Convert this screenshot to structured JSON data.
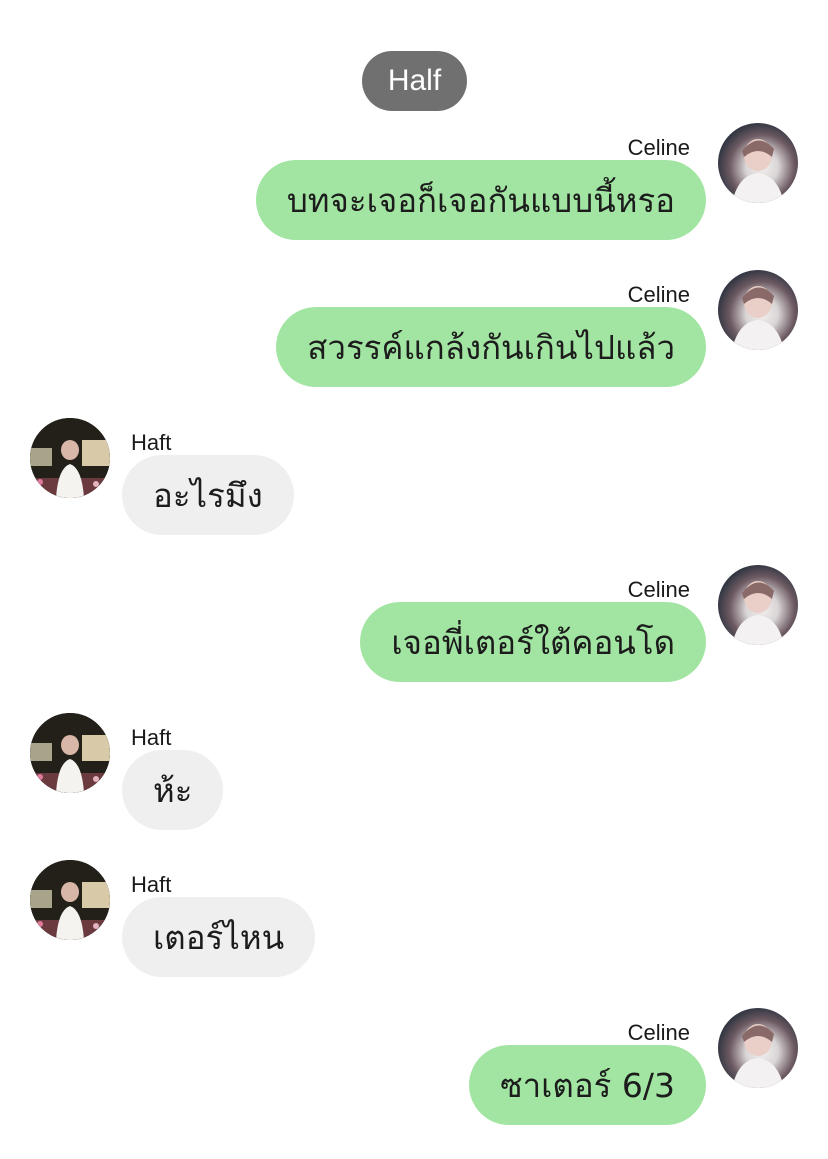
{
  "chat": {
    "header_name": "Half",
    "messages": [
      {
        "direction": "out",
        "sender": "Celine",
        "text": "บทจะเจอก็เจอกันแบบนี้หรอ",
        "avatar_icon": "celine-avatar"
      },
      {
        "direction": "out",
        "sender": "Celine",
        "text": "สวรรค์แกล้งกันเกินไปแล้ว",
        "avatar_icon": "celine-avatar"
      },
      {
        "direction": "in",
        "sender": "Haft",
        "text": "อะไรมึง",
        "avatar_icon": "haft-avatar"
      },
      {
        "direction": "out",
        "sender": "Celine",
        "text": "เจอพี่เตอร์ใต้คอนโด",
        "avatar_icon": "celine-avatar"
      },
      {
        "direction": "in",
        "sender": "Haft",
        "text": "ห้ะ",
        "avatar_icon": "haft-avatar"
      },
      {
        "direction": "in",
        "sender": "Haft",
        "text": "เตอร์ไหน",
        "avatar_icon": "haft-avatar"
      },
      {
        "direction": "out",
        "sender": "Celine",
        "text": "ซาเตอร์ 6/3",
        "avatar_icon": "celine-avatar"
      }
    ]
  },
  "colors": {
    "outgoing_bubble": "#a2e5a2",
    "incoming_bubble": "#efefef",
    "header_pill": "#707070"
  }
}
